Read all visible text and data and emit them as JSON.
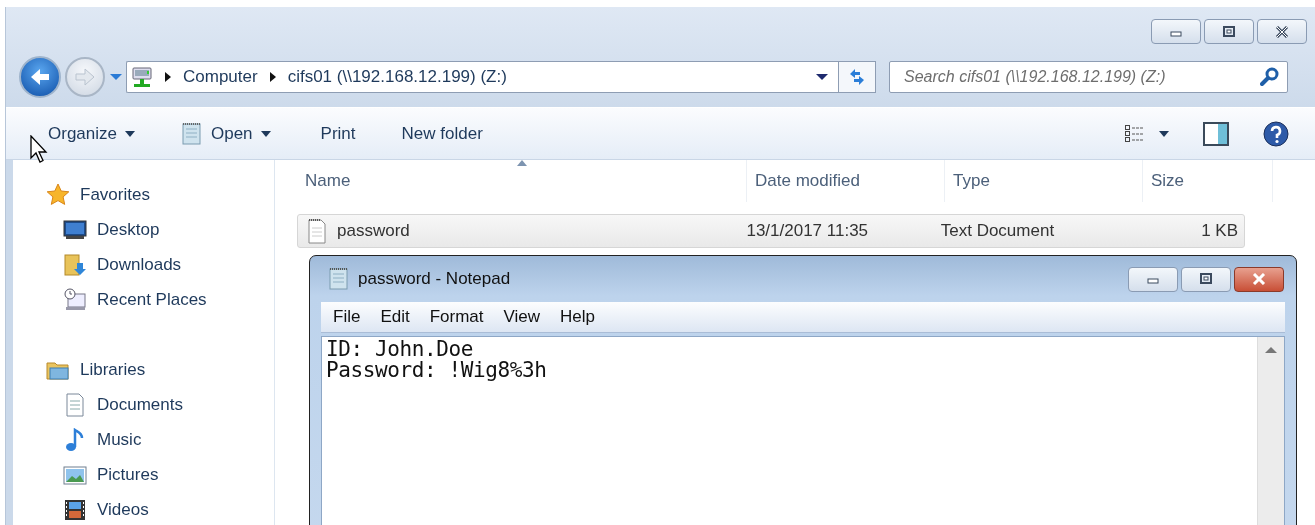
{
  "address_bar": {
    "crumbs": [
      "Computer",
      "cifs01 (\\\\192.168.12.199) (Z:)"
    ]
  },
  "search": {
    "placeholder": "Search cifs01 (\\\\192.168.12.199) (Z:)"
  },
  "toolbar": {
    "buttons": [
      {
        "label": "Organize",
        "dropdown": true
      },
      {
        "label": "Open",
        "dropdown": true
      },
      {
        "label": "Print",
        "dropdown": false
      },
      {
        "label": "New folder",
        "dropdown": false
      }
    ]
  },
  "sidebar": {
    "groups": [
      {
        "label": "Favorites",
        "items": [
          "Desktop",
          "Downloads",
          "Recent Places"
        ]
      },
      {
        "label": "Libraries",
        "items": [
          "Documents",
          "Music",
          "Pictures",
          "Videos"
        ]
      }
    ]
  },
  "table": {
    "columns": [
      {
        "label": "Name",
        "sorted": true
      },
      {
        "label": "Date modified",
        "sorted": false
      },
      {
        "label": "Type",
        "sorted": false
      },
      {
        "label": "Size",
        "sorted": false
      }
    ],
    "rows": [
      {
        "cells": [
          "password",
          "13/1/2017 11:35",
          "Text Document",
          "1 KB"
        ],
        "selected": true
      }
    ]
  },
  "notepad": {
    "title": "password - Notepad",
    "menu": [
      "File",
      "Edit",
      "Format",
      "View",
      "Help"
    ],
    "lines": [
      "ID: John.Doe",
      "Password: !Wig8%3h"
    ]
  }
}
